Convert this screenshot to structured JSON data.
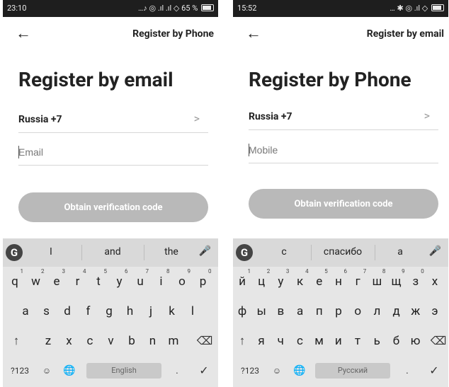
{
  "left": {
    "status": {
      "time": "23:10",
      "icons": "…♪ ◎ .ıl .ıl ◇",
      "battery": "65 %"
    },
    "toplink": "Register by Phone",
    "title": "Register by email",
    "country": "Russia +7",
    "chevron": ">",
    "input_placeholder": "Email",
    "button": "Obtain verification code",
    "keyboard": {
      "suggestions": [
        "I",
        "and",
        "the"
      ],
      "row1": [
        {
          "k": "q",
          "n": "1"
        },
        {
          "k": "w",
          "n": "2"
        },
        {
          "k": "e",
          "n": "3"
        },
        {
          "k": "r",
          "n": "4"
        },
        {
          "k": "t",
          "n": "5"
        },
        {
          "k": "y",
          "n": "6"
        },
        {
          "k": "u",
          "n": "7"
        },
        {
          "k": "i",
          "n": "8"
        },
        {
          "k": "o",
          "n": "9"
        },
        {
          "k": "p",
          "n": "0"
        }
      ],
      "row2": [
        "a",
        "s",
        "d",
        "f",
        "g",
        "h",
        "j",
        "k",
        "l"
      ],
      "row3": [
        "z",
        "x",
        "c",
        "v",
        "b",
        "n",
        "m"
      ],
      "symbols": "?123",
      "space": "English",
      "period": "."
    }
  },
  "right": {
    "status": {
      "time": "15:52",
      "icons": "… ✱ ◎ .ıl ◇"
    },
    "toplink": "Register by email",
    "title": "Register by Phone",
    "country": "Russia +7",
    "chevron": ">",
    "input_placeholder": "Mobile",
    "button": "Obtain verification code",
    "keyboard": {
      "suggestions": [
        "с",
        "спасибо",
        "а"
      ],
      "row1": [
        {
          "k": "й",
          "n": "1"
        },
        {
          "k": "ц",
          "n": "2"
        },
        {
          "k": "у",
          "n": "3"
        },
        {
          "k": "к",
          "n": "4"
        },
        {
          "k": "е",
          "n": "5"
        },
        {
          "k": "н",
          "n": "6"
        },
        {
          "k": "г",
          "n": "7"
        },
        {
          "k": "ш",
          "n": "8"
        },
        {
          "k": "щ",
          "n": "9"
        },
        {
          "k": "з",
          "n": "0"
        },
        {
          "k": "х",
          "n": ""
        }
      ],
      "row2": [
        "ф",
        "ы",
        "в",
        "а",
        "п",
        "р",
        "о",
        "л",
        "д",
        "ж",
        "э"
      ],
      "row3": [
        "я",
        "ч",
        "с",
        "м",
        "и",
        "т",
        "ь",
        "б",
        "ю"
      ],
      "symbols": "?123",
      "space": "Русский",
      "period": "."
    }
  },
  "icons": {
    "back": "←",
    "google": "G",
    "mic": "🎤",
    "shift": "↑",
    "backspace": "⌫",
    "globe": "🌐",
    "done": "✓",
    "emoji": "☺"
  }
}
